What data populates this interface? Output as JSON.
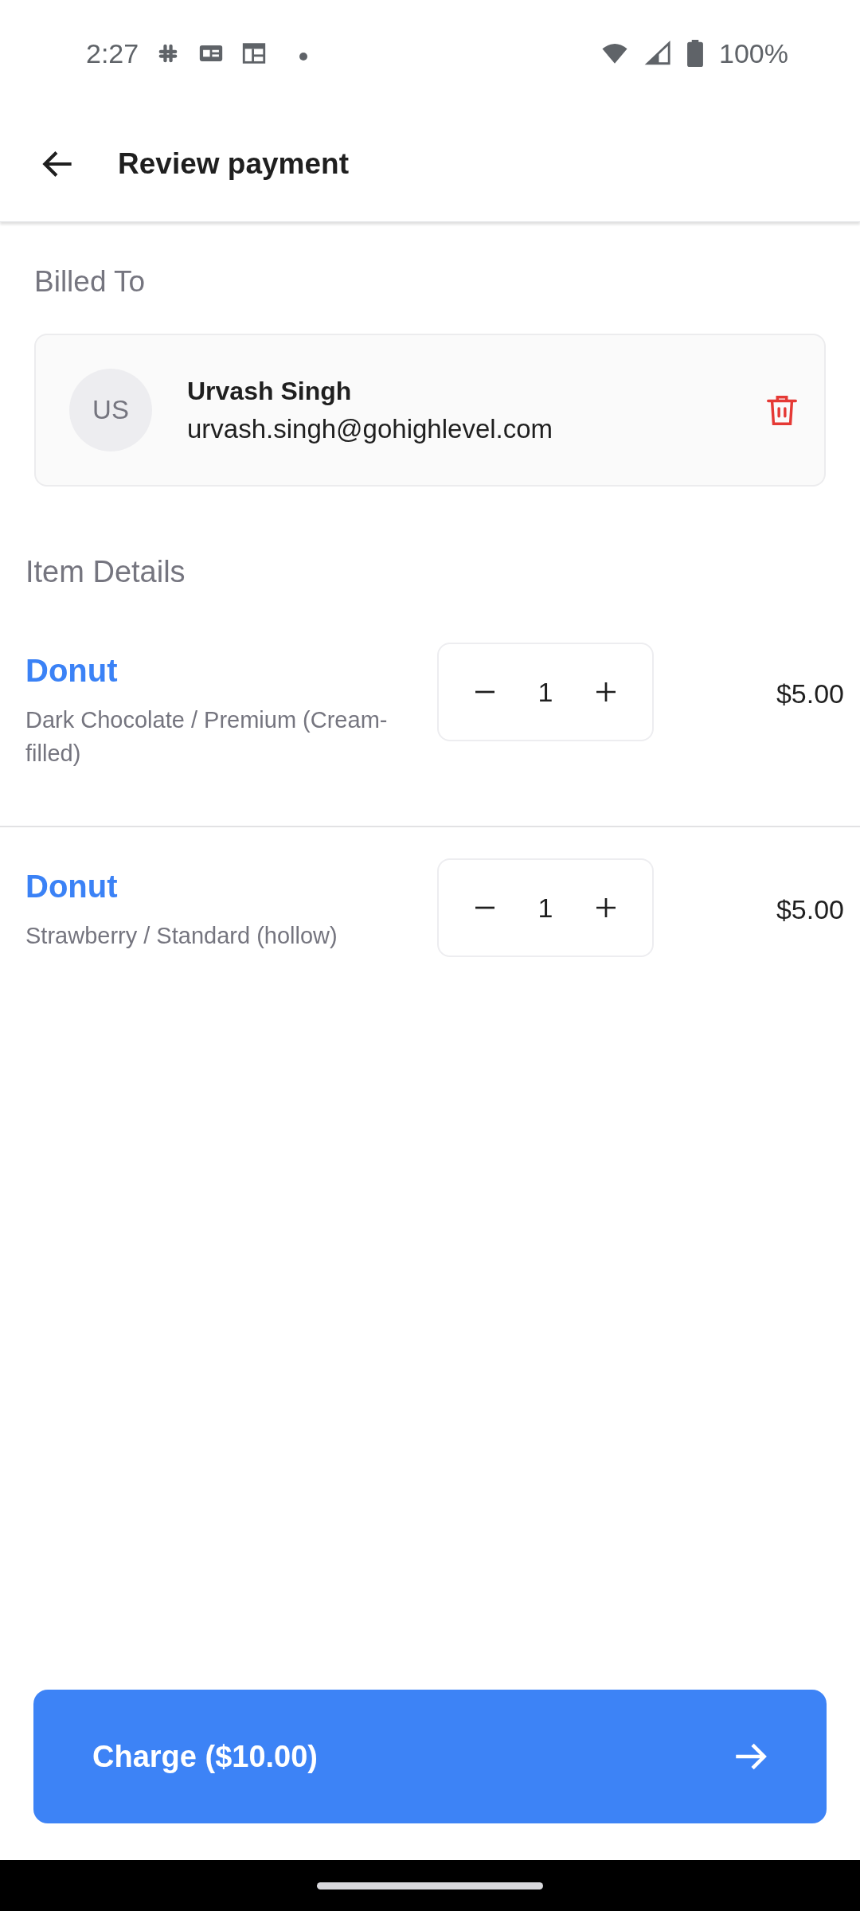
{
  "status_bar": {
    "time": "2:27",
    "battery": "100%"
  },
  "app_bar": {
    "title": "Review payment"
  },
  "billed_to": {
    "heading": "Billed To",
    "initials": "US",
    "name": "Urvash Singh",
    "email": "urvash.singh@gohighlevel.com"
  },
  "items_heading": "Item Details",
  "items": [
    {
      "name": "Donut",
      "options": "Dark Chocolate  / Premium (Cream-filled)",
      "quantity": "1",
      "price": "$5.00"
    },
    {
      "name": "Donut",
      "options": "Strawberry  / Standard (hollow)",
      "quantity": "1",
      "price": "$5.00"
    }
  ],
  "charge_button": {
    "label": "Charge ($10.00)"
  }
}
